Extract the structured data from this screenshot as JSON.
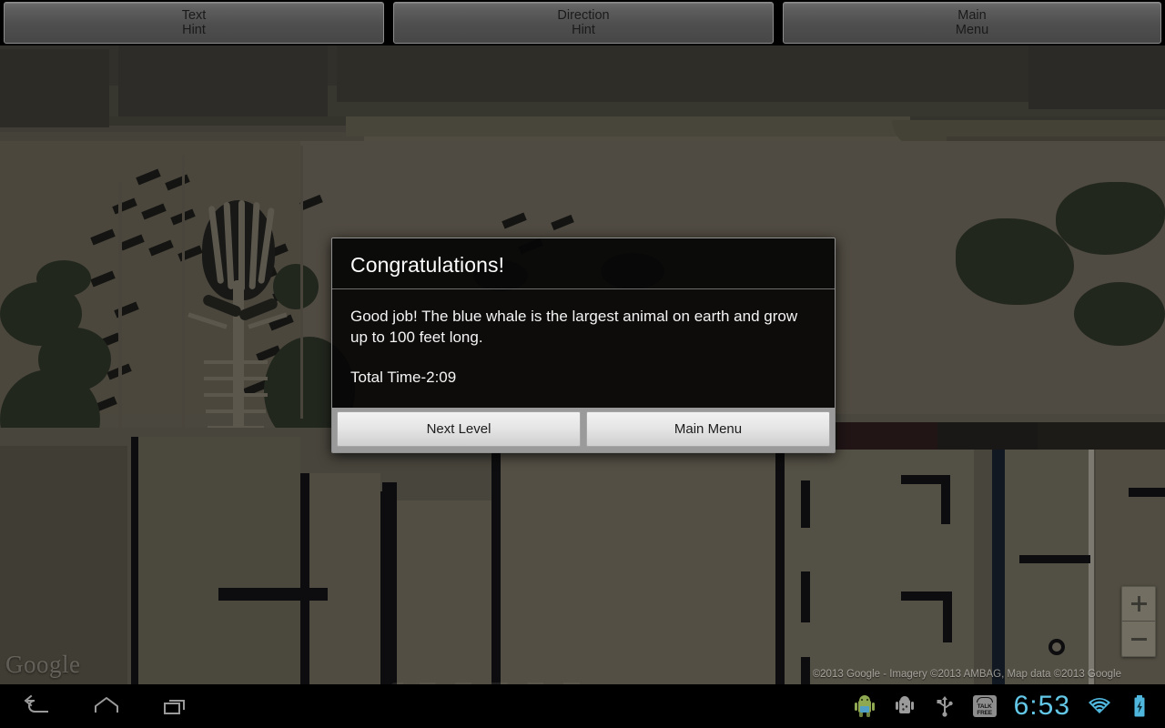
{
  "app": {
    "title": "Geo Scavenger Hunt Game",
    "platform": "android-tablet"
  },
  "hint_bar": {
    "buttons": [
      {
        "name": "text-hint",
        "line1": "Text",
        "line2": "Hint"
      },
      {
        "name": "direction-hint",
        "line1": "Direction",
        "line2": "Hint"
      },
      {
        "name": "main-menu",
        "line1": "Main",
        "line2": "Menu"
      }
    ]
  },
  "map": {
    "type": "satellite-aerial",
    "watermark": "Google",
    "attribution": "©2013 Google - Imagery ©2013 AMBAG, Map data ©2013 Google",
    "zoom_controls": {
      "zoom_in_label": "+",
      "zoom_out_label": "−"
    }
  },
  "dialog": {
    "title": "Congratulations!",
    "message": "Good job!  The blue whale is the largest animal on earth and grow up to 100 feet long.",
    "total_time": "Total Time-2:09",
    "buttons": [
      {
        "name": "next-level",
        "label": "Next Level"
      },
      {
        "name": "main-menu",
        "label": "Main Menu"
      }
    ]
  },
  "nav_bar": {
    "system_buttons": [
      {
        "name": "back-icon",
        "label": "Back"
      },
      {
        "name": "home-icon",
        "label": "Home"
      },
      {
        "name": "recent-apps-icon",
        "label": "Recent Apps"
      }
    ],
    "status_icons": [
      {
        "name": "android-notification-icon",
        "label": "Android"
      },
      {
        "name": "android-debug-icon",
        "label": "USB Debugging"
      },
      {
        "name": "usb-icon",
        "label": "USB Connected"
      },
      {
        "name": "talk-free-icon",
        "label": "TALK FREE"
      },
      {
        "name": "wifi-icon",
        "label": "Wi-Fi"
      },
      {
        "name": "battery-charging-icon",
        "label": "Battery Charging"
      }
    ],
    "clock": "6:53",
    "talk_free_line1": "TALK",
    "talk_free_line2": "FREE"
  },
  "colors": {
    "clock_cyan": "#63c8e8",
    "dialog_bg": "#060606",
    "dialog_footer": "#9a9a9a",
    "hint_button": "#4e4e4e"
  }
}
